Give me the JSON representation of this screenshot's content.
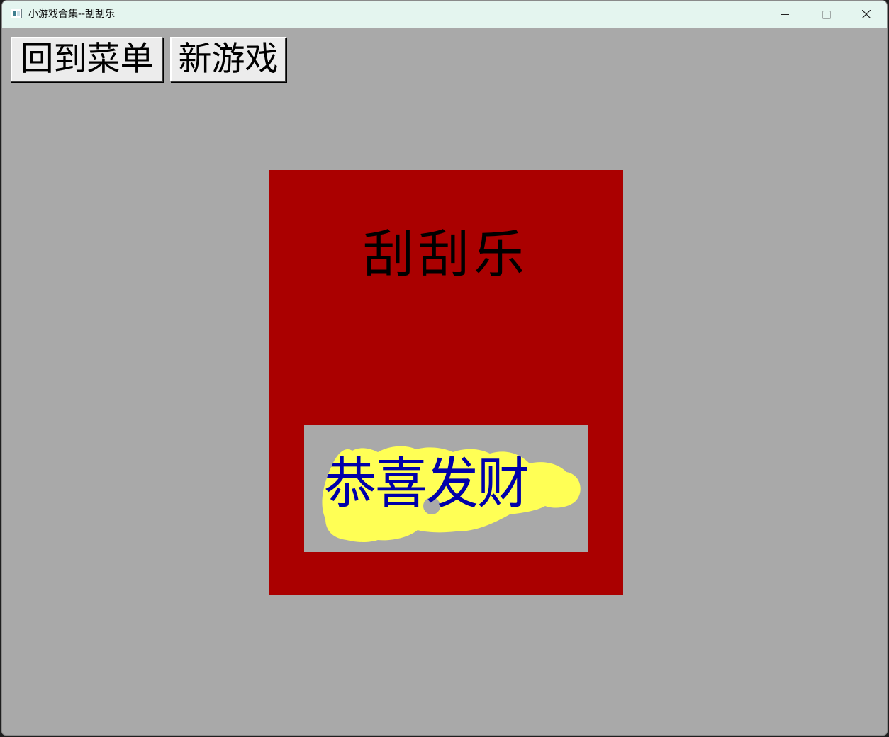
{
  "window": {
    "title": "小游戏合集--刮刮乐"
  },
  "toolbar": {
    "menu_label": "回到菜单",
    "new_game_label": "新游戏"
  },
  "card": {
    "title": "刮刮乐",
    "prize": "恭喜发财",
    "colors": {
      "card": "#aa0000",
      "background": "#a9a9a9",
      "scratched": "#ffff55",
      "prize_text": "#0000aa"
    }
  },
  "icons": {
    "app": "app-window-icon",
    "minimize": "minimize-icon",
    "maximize": "maximize-icon",
    "close": "close-icon"
  }
}
